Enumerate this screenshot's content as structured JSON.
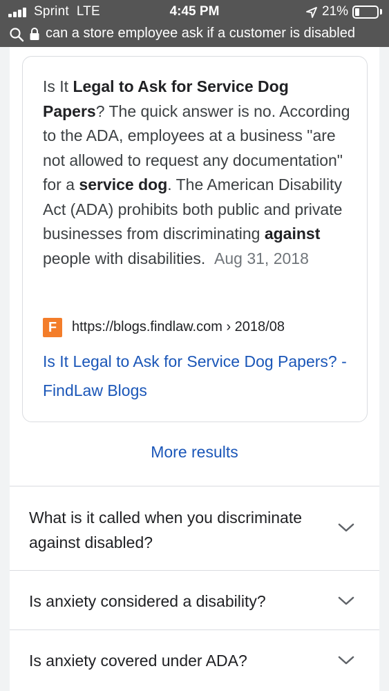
{
  "status_bar": {
    "carrier": "Sprint",
    "network": "LTE",
    "time": "4:45 PM",
    "battery": "21%",
    "battery_level": 0.21
  },
  "address_bar": {
    "query": "can a store employee ask if a customer is disabled"
  },
  "featured_snippet": {
    "t1": "Is It ",
    "b1": "Legal to Ask for Service Dog Papers",
    "t2": "? The quick answer is no. According to the ADA, employees at a business \"are not allowed to request any documentation\" for a ",
    "b2": "service dog",
    "t3": ". The American Disability Act (ADA) prohibits both public and private businesses from discriminating ",
    "b3": "against",
    "t4": " people with disabilities.",
    "date": "Aug 31, 2018",
    "favicon_letter": "F",
    "source_url": "https://blogs.findlaw.com › 2018/08",
    "link_title": "Is It Legal to Ask for Service Dog Papers? - FindLaw Blogs"
  },
  "more_results": "More results",
  "related_questions": [
    {
      "question": "What is it called when you discriminate against disabled?"
    },
    {
      "question": "Is anxiety considered a disability?"
    },
    {
      "question": "Is anxiety covered under ADA?"
    }
  ],
  "colors": {
    "topbar": "#555555",
    "link": "#1a56b8",
    "favicon": "#f37d2a",
    "page_bg": "#f1f3f4"
  }
}
